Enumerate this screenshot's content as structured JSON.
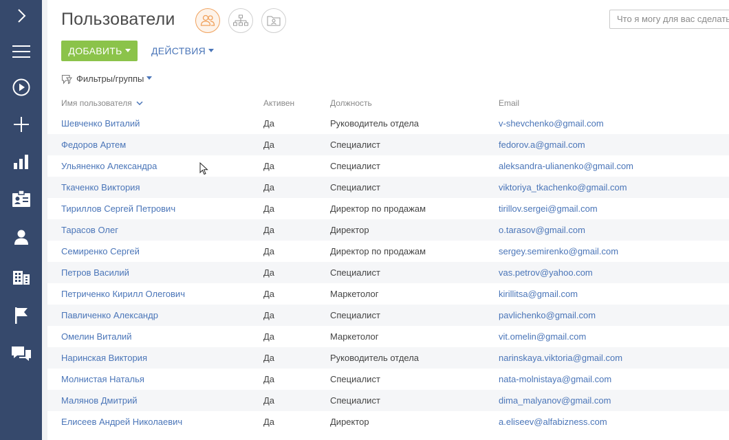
{
  "sidebar": {
    "items": [
      {
        "icon": "chevron-right-icon"
      },
      {
        "icon": "menu-icon"
      },
      {
        "icon": "play-circle-icon"
      },
      {
        "icon": "plus-icon"
      },
      {
        "icon": "bar-chart-icon"
      },
      {
        "icon": "id-card-icon"
      },
      {
        "icon": "person-icon"
      },
      {
        "icon": "building-icon"
      },
      {
        "icon": "flag-icon"
      },
      {
        "icon": "chat-icon"
      }
    ],
    "background": "#36496c"
  },
  "header": {
    "title": "Пользователи",
    "views": [
      "users-view-icon",
      "org-structure-icon",
      "roles-folder-icon"
    ],
    "search_placeholder": "Что я могу для вас сделать?"
  },
  "toolbar": {
    "add_label": "ДОБАВИТЬ",
    "actions_label": "ДЕЙСТВИЯ",
    "add_color": "#8bc34a",
    "link_color": "#4a75b8"
  },
  "filters": {
    "label": "Фильтры/группы"
  },
  "table": {
    "columns": {
      "name": "Имя пользователя",
      "active": "Активен",
      "job": "Должность",
      "email": "Email"
    },
    "rows": [
      {
        "name": "Шевченко Виталий",
        "active": "Да",
        "job": "Руководитель отдела",
        "email": "v-shevchenko@gmail.com"
      },
      {
        "name": "Федоров Артем",
        "active": "Да",
        "job": "Специалист",
        "email": "fedorov.a@gmail.com"
      },
      {
        "name": "Ульяненко Александра",
        "active": "Да",
        "job": "Специалист",
        "email": "aleksandra-ulianenko@gmail.com"
      },
      {
        "name": "Ткаченко Виктория",
        "active": "Да",
        "job": "Специалист",
        "email": "viktoriya_tkachenko@gmail.com"
      },
      {
        "name": "Тириллов Сергей Петрович",
        "active": "Да",
        "job": "Директор по продажам",
        "email": "tirillov.sergei@gmail.com"
      },
      {
        "name": "Тарасов Олег",
        "active": "Да",
        "job": "Директор",
        "email": "o.tarasov@gmail.com"
      },
      {
        "name": "Семиренко Сергей",
        "active": "Да",
        "job": "Директор по продажам",
        "email": "sergey.semirenko@gmail.com"
      },
      {
        "name": "Петров Василий",
        "active": "Да",
        "job": "Специалист",
        "email": "vas.petrov@yahoo.com"
      },
      {
        "name": "Петриченко Кирилл Олегович",
        "active": "Да",
        "job": "Маркетолог",
        "email": "kirillitsa@gmail.com"
      },
      {
        "name": "Павличенко Александр",
        "active": "Да",
        "job": "Специалист",
        "email": "pavlichenko@gmail.com"
      },
      {
        "name": "Омелин Виталий",
        "active": "Да",
        "job": "Маркетолог",
        "email": "vit.omelin@gmail.com"
      },
      {
        "name": "Наринская Виктория",
        "active": "Да",
        "job": "Руководитель отдела",
        "email": "narinskaya.viktoria@gmail.com"
      },
      {
        "name": "Молнистая Наталья",
        "active": "Да",
        "job": "Специалист",
        "email": "nata-molnistaya@gmail.com"
      },
      {
        "name": "Малянов Дмитрий",
        "active": "Да",
        "job": "Специалист",
        "email": "dima_malyanov@gmail.com"
      },
      {
        "name": "Елисеев Андрей Николаевич",
        "active": "Да",
        "job": "Директор",
        "email": "a.eliseev@alfabizness.com"
      }
    ]
  }
}
